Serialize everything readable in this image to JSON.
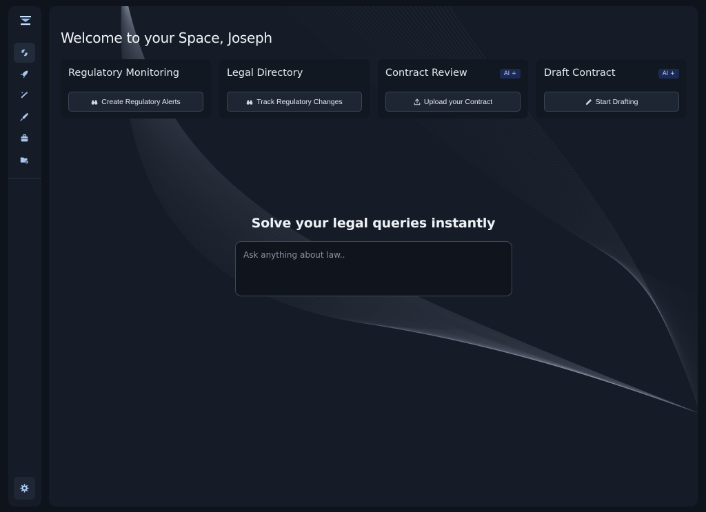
{
  "welcome": {
    "text": "Welcome to your Space, Joseph"
  },
  "sidebar": {
    "nav_icons": [
      "spin-icon",
      "rocket-icon",
      "magic-wand-icon",
      "pen-nib-icon",
      "toolbox-icon",
      "folder-settings-icon"
    ],
    "active_index": 0,
    "settings_icon": "gear-icon"
  },
  "cards": [
    {
      "title": "Regulatory Monitoring",
      "badge": "",
      "button_label": "Create Regulatory Alerts",
      "button_icon": "binoculars-icon"
    },
    {
      "title": "Legal Directory",
      "badge": "",
      "button_label": "Track Regulatory Changes",
      "button_icon": "binoculars-icon"
    },
    {
      "title": "Contract Review",
      "badge": "AI +",
      "button_label": "Upload your Contract",
      "button_icon": "upload-icon"
    },
    {
      "title": "Draft Contract",
      "badge": "AI +",
      "button_label": "Start Drafting",
      "button_icon": "pencil-icon"
    }
  ],
  "query": {
    "title": "Solve your legal queries instantly",
    "placeholder": "Ask anything about law.."
  },
  "colors": {
    "page_background": "#0f131b",
    "panel_background": "#161c27",
    "card_background": "#121821",
    "accent_icon": "#a9c6f2",
    "badge_background": "#1b2a54",
    "input_border": "#3a4a63"
  }
}
